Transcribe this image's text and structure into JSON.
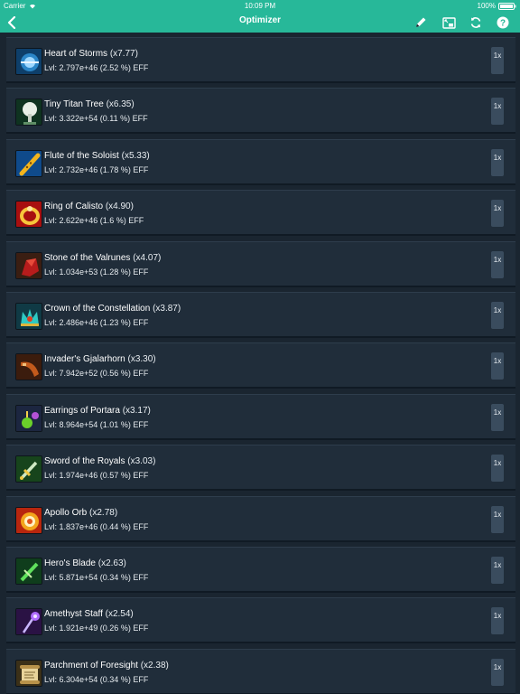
{
  "status_bar": {
    "carrier": "Carrier",
    "time": "10:09 PM",
    "battery": "100%"
  },
  "nav": {
    "title": "Optimizer"
  },
  "colors": {
    "accent": "#27b899",
    "row_bg": "#202d3a",
    "page_bg": "#1a2530"
  },
  "items": [
    {
      "name": "Heart of Storms",
      "multiplier": "(x7.77)",
      "level": "Lvl: 2.797e+46 (2.52 %) EFF",
      "button": "1x",
      "icon": "heart-of-storms-icon"
    },
    {
      "name": "Tiny Titan Tree",
      "multiplier": "(x6.35)",
      "level": "Lvl: 3.322e+54 (0.11 %) EFF",
      "button": "1x",
      "icon": "tiny-titan-tree-icon"
    },
    {
      "name": "Flute of the Soloist",
      "multiplier": "(x5.33)",
      "level": "Lvl: 2.732e+46 (1.78 %) EFF",
      "button": "1x",
      "icon": "flute-icon"
    },
    {
      "name": "Ring of Calisto",
      "multiplier": "(x4.90)",
      "level": "Lvl: 2.622e+46 (1.6 %) EFF",
      "button": "1x",
      "icon": "ring-icon"
    },
    {
      "name": "Stone of the Valrunes",
      "multiplier": "(x4.07)",
      "level": "Lvl: 1.034e+53 (1.28 %) EFF",
      "button": "1x",
      "icon": "stone-icon"
    },
    {
      "name": "Crown of the Constellation",
      "multiplier": "(x3.87)",
      "level": "Lvl: 2.486e+46 (1.23 %) EFF",
      "button": "1x",
      "icon": "crown-icon"
    },
    {
      "name": "Invader's Gjalarhorn",
      "multiplier": "(x3.30)",
      "level": "Lvl: 7.942e+52 (0.56 %) EFF",
      "button": "1x",
      "icon": "horn-icon"
    },
    {
      "name": "Earrings of Portara",
      "multiplier": "(x3.17)",
      "level": "Lvl: 8.964e+54 (1.01 %) EFF",
      "button": "1x",
      "icon": "earrings-icon"
    },
    {
      "name": "Sword of the Royals",
      "multiplier": "(x3.03)",
      "level": "Lvl: 1.974e+46 (0.57 %) EFF",
      "button": "1x",
      "icon": "sword-icon"
    },
    {
      "name": "Apollo Orb",
      "multiplier": "(x2.78)",
      "level": "Lvl: 1.837e+46 (0.44 %) EFF",
      "button": "1x",
      "icon": "orb-icon"
    },
    {
      "name": "Hero's Blade",
      "multiplier": "(x2.63)",
      "level": "Lvl: 5.871e+54 (0.34 %) EFF",
      "button": "1x",
      "icon": "blade-icon"
    },
    {
      "name": "Amethyst Staff",
      "multiplier": "(x2.54)",
      "level": "Lvl: 1.921e+49 (0.26 %) EFF",
      "button": "1x",
      "icon": "staff-icon"
    },
    {
      "name": "Parchment of Foresight",
      "multiplier": "(x2.38)",
      "level": "Lvl: 6.304e+54 (0.34 %) EFF",
      "button": "1x",
      "icon": "parchment-icon"
    }
  ]
}
